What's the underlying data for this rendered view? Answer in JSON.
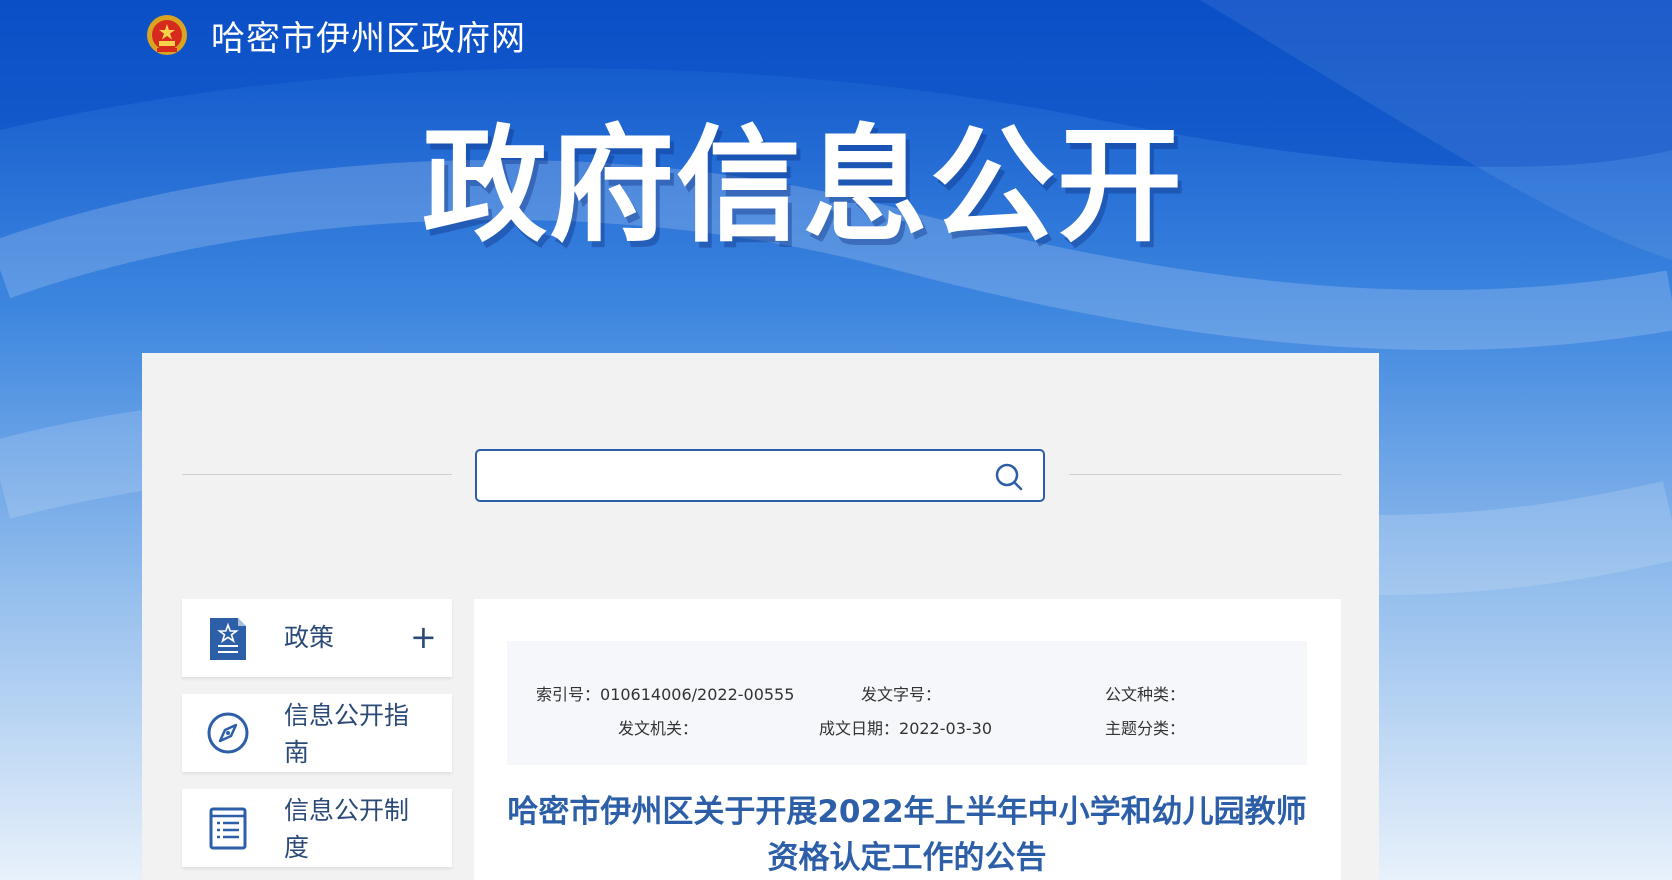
{
  "header": {
    "site_name": "哈密市伊州区政府网",
    "emblem_icon": "national-emblem-icon"
  },
  "hero": {
    "title": "政府信息公开"
  },
  "search": {
    "placeholder": "",
    "value": "",
    "icon": "search-icon"
  },
  "sidebar": {
    "items": [
      {
        "label": "政策",
        "icon": "policy-document-icon",
        "expand": "+"
      },
      {
        "label": "信息公开指南",
        "icon": "compass-icon"
      },
      {
        "label": "信息公开制度",
        "icon": "list-document-icon"
      }
    ]
  },
  "article": {
    "meta": {
      "index_label": "索引号：",
      "index_value": "010614006/2022-00555",
      "doc_no_label": "发文字号：",
      "doc_no_value": "",
      "doc_type_label": "公文种类：",
      "doc_type_value": "",
      "issuer_label": "发文机关：",
      "issuer_value": "",
      "date_label": "成文日期：",
      "date_value": "2022-03-30",
      "topic_label": "主题分类：",
      "topic_value": ""
    },
    "title": "哈密市伊州区关于开展2022年上半年中小学和幼儿园教师资格认定工作的公告"
  },
  "colors": {
    "primary_blue": "#2d5fa8",
    "nav_text": "#2c4a78",
    "panel_bg": "#f2f2f2"
  }
}
